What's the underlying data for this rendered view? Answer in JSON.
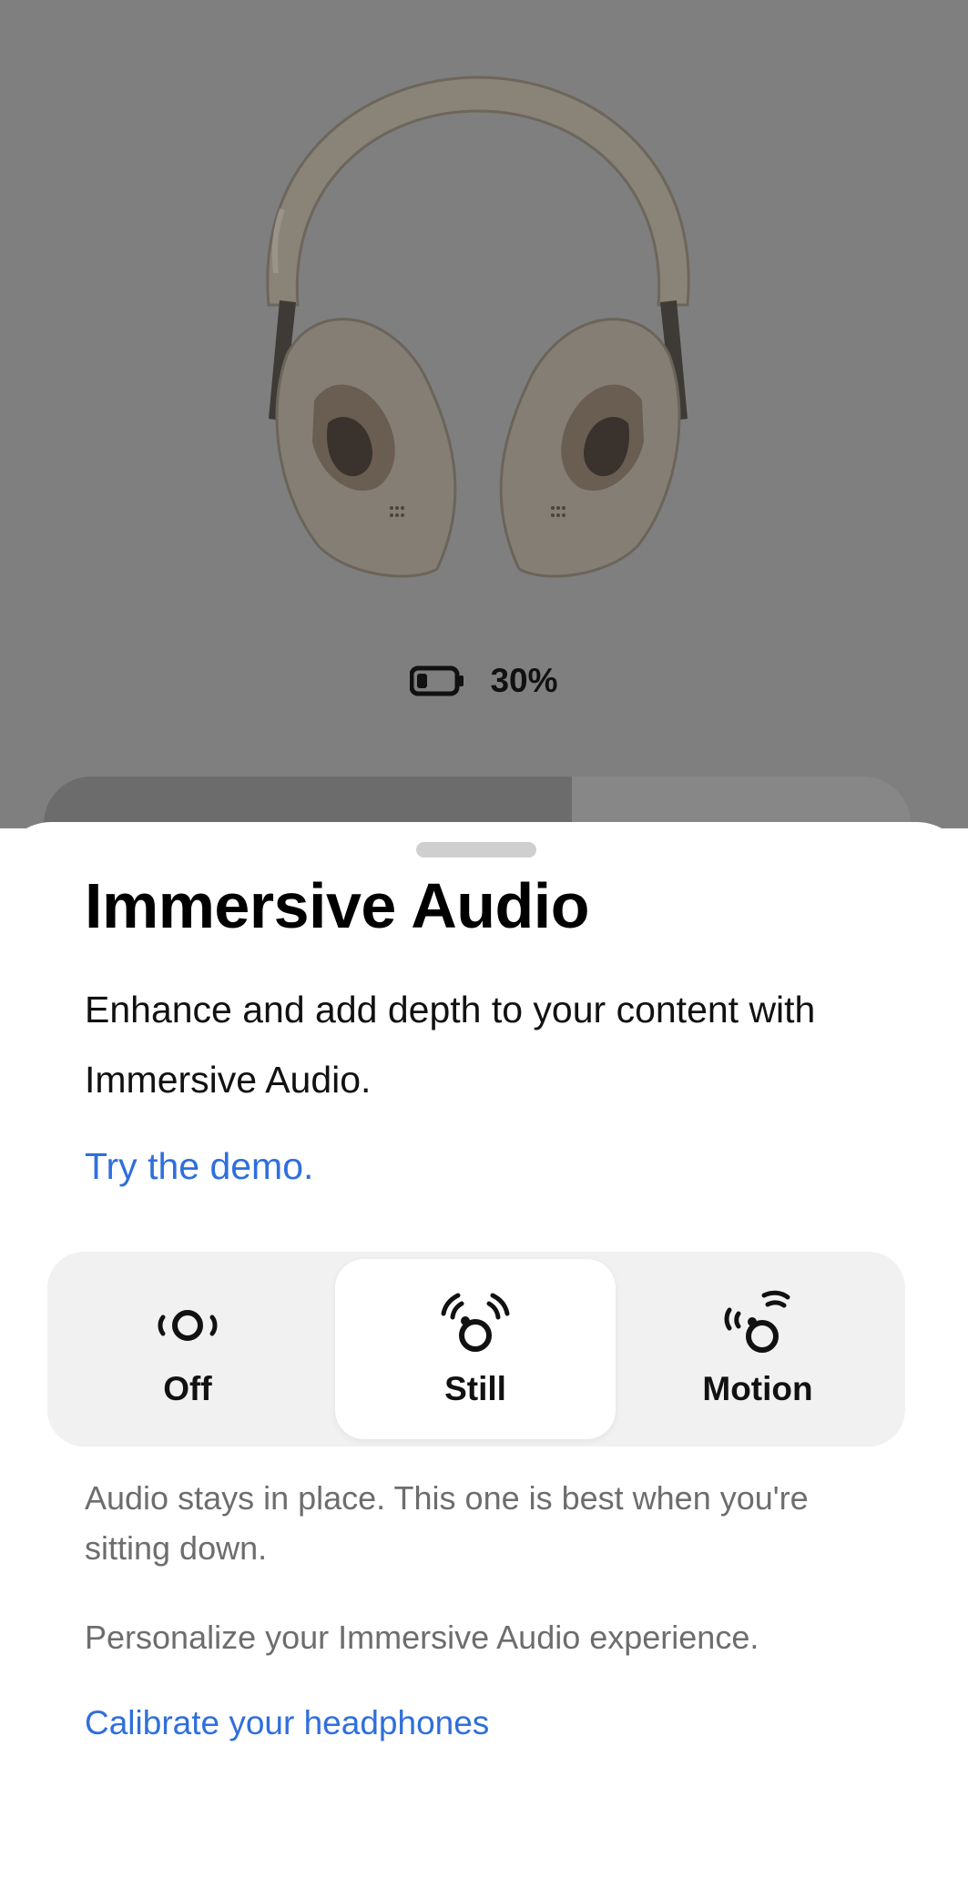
{
  "device": {
    "battery_percent_text": "30%",
    "battery_level": 0.3,
    "product_image": "headphones-illustration"
  },
  "sheet": {
    "title": "Immersive Audio",
    "description": "Enhance and add depth to your content with Immersive Audio.",
    "demo_link": "Try the demo.",
    "modes": [
      {
        "label": "Off",
        "icon": "immersive-off-icon",
        "selected": false
      },
      {
        "label": "Still",
        "icon": "immersive-still-icon",
        "selected": true
      },
      {
        "label": "Motion",
        "icon": "immersive-motion-icon",
        "selected": false
      }
    ],
    "mode_description": "Audio stays in place. This one is best when you're sitting down.",
    "personalize_text": "Personalize your Immersive Audio experience.",
    "calibrate_link": "Calibrate your headphones"
  },
  "colors": {
    "backdrop": "#7f7f7f",
    "link": "#2f6fdb",
    "secondary_text": "#6d6d6d",
    "segment_bg": "#f1f1f1"
  }
}
